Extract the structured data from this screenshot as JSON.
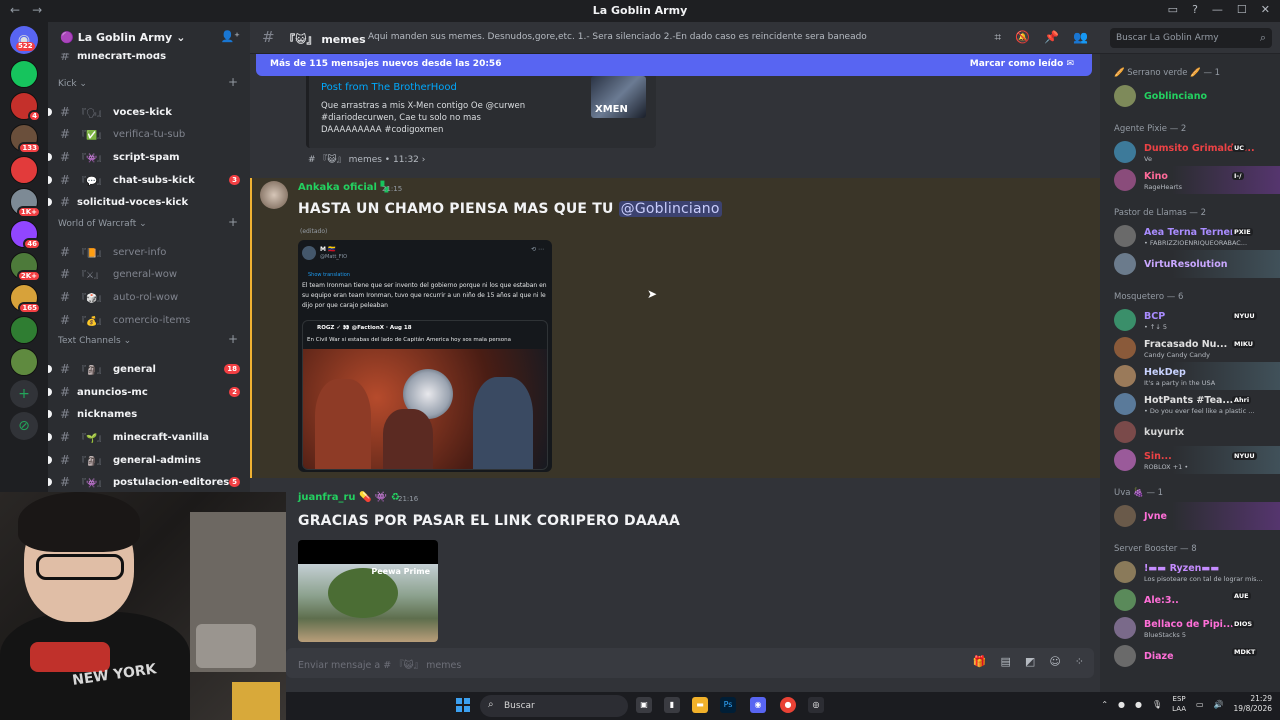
{
  "window": {
    "title": "La Goblin Army",
    "back": "←",
    "forward": "→"
  },
  "server_list": {
    "badges": [
      "522",
      "4",
      "133",
      "1K+",
      "46",
      "2K+",
      "165"
    ]
  },
  "sidebar": {
    "server_name": "La Goblin Army",
    "top_partial": "minecraft-mods",
    "categories": [
      {
        "label": "Kick",
        "channels": [
          {
            "name": "voces-kick",
            "emoji": "『🗣』",
            "unread": true
          },
          {
            "name": "verifica-tu-sub",
            "emoji": "『✅』",
            "unread": false
          },
          {
            "name": "script-spam",
            "emoji": "『👾』",
            "unread": true
          },
          {
            "name": "chat-subs-kick",
            "emoji": "『💬』",
            "unread": true,
            "badge": "3"
          },
          {
            "name": "solicitud-voces-kick",
            "emoji": "",
            "unread": true
          }
        ]
      },
      {
        "label": "World of Warcraft",
        "channels": [
          {
            "name": "server-info",
            "emoji": "『📙』",
            "unread": false
          },
          {
            "name": "general-wow",
            "emoji": "『⚔』",
            "unread": false
          },
          {
            "name": "auto-rol-wow",
            "emoji": "『🎲』",
            "unread": false
          },
          {
            "name": "comercio-items",
            "emoji": "『💰』",
            "unread": false
          }
        ]
      },
      {
        "label": "Text Channels",
        "channels": [
          {
            "name": "general",
            "emoji": "『🗿』",
            "unread": true,
            "badge": "18"
          },
          {
            "name": "anuncios-mc",
            "emoji": "",
            "unread": true,
            "badge": "2"
          },
          {
            "name": "nicknames",
            "emoji": "",
            "unread": true
          },
          {
            "name": "minecraft-vanilla",
            "emoji": "『🌱』",
            "unread": true
          },
          {
            "name": "general-admins",
            "emoji": "『🗿』",
            "unread": true
          },
          {
            "name": "postulacion-editores",
            "emoji": "『👾』",
            "unread": true,
            "badge": "5"
          }
        ]
      }
    ]
  },
  "channel_header": {
    "emoji": "『😺』",
    "name": "memes",
    "topic": "Aqui manden sus memes. Desnudos,gore,etc. 1.- Sera silenciado 2.-En dado caso es reincidente sera baneado",
    "search_placeholder": "Buscar La Goblin Army"
  },
  "new_messages_bar": {
    "text": "Más de 115 mensajes nuevos desde las 20:56",
    "action": "Marcar como leído"
  },
  "forwarded_embed": {
    "title": "Post from The BrotherHood",
    "description": "Que arrastras a mis X-Men contigo Oe @curwen #diariodecurwen, Cae tu solo no mas DAAAAAAAAA #codigoxmen",
    "thumb_label": "XMEN",
    "footer": "# 『😺』 memes • 11:32 ›"
  },
  "messages": [
    {
      "author": "Ankaka oficial",
      "time": "21:15",
      "text": "HASTA UN CHAMO PIENSA MAS QUE TU",
      "mention": "@Goblinciano",
      "edited": "(editado)",
      "tweet": {
        "name": "M 🇻🇪",
        "handle": "@Matt_FIO",
        "translate": "Show translation",
        "body": "El team Ironman tiene que ser invento del gobierno porque ni los que estaban en su equipo eran team Ironman, tuvo que recurrir a un niño de 15 años al que ni le dijo por que carajo peleaban",
        "quote_name": "ROGZ ✓ 👀 @FactionX · Aug 18",
        "quote_body": "En Civil War si estabas del lado de Capitán America hoy sos mala persona"
      }
    },
    {
      "author": "juanfra_ru",
      "time": "21:16",
      "text": "GRACIAS POR PASAR EL LINK CORIPERO DAAAA",
      "image_label": "Peewa Prime"
    }
  ],
  "composer": {
    "placeholder": "Enviar mensaje a # 『😺』 memes"
  },
  "members": [
    {
      "category": "🥖 Serrano verde 🥖 — 1",
      "items": [
        {
          "name": "Goblinciano",
          "status": "",
          "color": "#23d160"
        }
      ]
    },
    {
      "category": "Agente Pixie — 2",
      "items": [
        {
          "name": "Dumsito Grimaldo ...",
          "status": "Ve",
          "color": "#ed4245",
          "tag": "UC"
        },
        {
          "name": "Kino",
          "status": "RageHearts",
          "color": "#ff6b9a",
          "tag": "I-/"
        }
      ]
    },
    {
      "category": "Pastor de Llamas — 2",
      "items": [
        {
          "name": "Aea Terna Ternera",
          "status": "• FABRIZZIOENRIQUEORABAC...",
          "color": "#a98cff",
          "tag": "PXIE"
        },
        {
          "name": "VirtuResolution",
          "status": "",
          "color": "#c9a7ff"
        }
      ]
    },
    {
      "category": "Mosquetero — 6",
      "items": [
        {
          "name": "BCP",
          "status": "• ↑↓ 5",
          "color": "#a98cff",
          "tag": "NYUU"
        },
        {
          "name": "Fracasado Nu...",
          "status": "Candy Candy Candy",
          "color": "#e0e0e0",
          "tag": "MIKU"
        },
        {
          "name": "HekDep",
          "status": "It's a party in the USA",
          "color": "#c9d3ff"
        },
        {
          "name": "HotPants #Tea...",
          "status": "• Do you ever feel like a plastic ...",
          "color": "#e0e0e0",
          "tag": "Ahri"
        },
        {
          "name": "kuyurix",
          "status": "",
          "color": "#d6d6d6"
        },
        {
          "name": "Sin...",
          "status": "ROBLOX +1 •",
          "color": "#ed4245",
          "tag": "NYUU"
        }
      ]
    },
    {
      "category": "Uva 🍇 — 1",
      "items": [
        {
          "name": "Jvne",
          "status": "",
          "color": "#ff6fd8"
        }
      ]
    },
    {
      "category": "Server Booster — 8",
      "items": [
        {
          "name": "!▬▬ Ryzen▬▬",
          "status": "Los pisoteare con tal de lograr mis...",
          "color": "#c58cff"
        },
        {
          "name": "Ale:3..",
          "status": "",
          "color": "#ff6fd8",
          "tag": "AUE"
        },
        {
          "name": "Bellaco de Pipi...",
          "status": "BlueStacks 5",
          "color": "#ff6fd8",
          "tag": "DIOS"
        },
        {
          "name": "Diaze",
          "status": "",
          "color": "#ff6fd8",
          "tag": "MDKT"
        }
      ]
    }
  ],
  "webcam": {
    "shirt_text": "NEW YORK"
  },
  "taskbar": {
    "search_label": "Buscar",
    "lang_top": "ESP",
    "lang_bottom": "LAA",
    "time": "21:29",
    "date": "19/8/2026"
  },
  "colors": {
    "accent": "#5865f2",
    "highlight": "#f0b232",
    "link": "#00a8fc",
    "danger": "#f23f43"
  }
}
